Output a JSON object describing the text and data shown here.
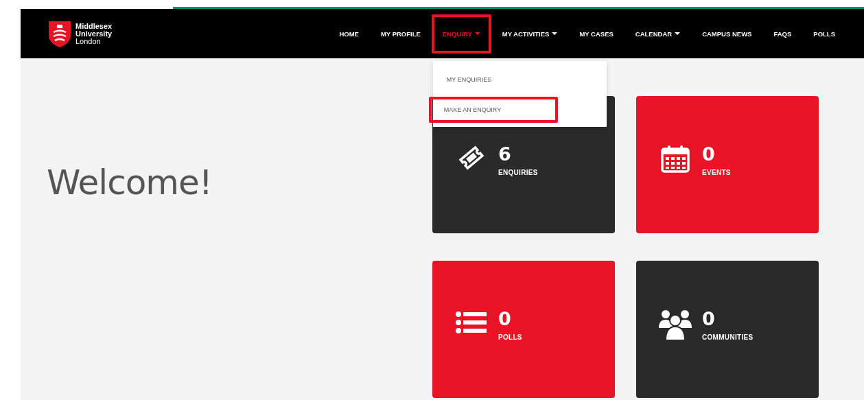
{
  "logo": {
    "lines": [
      "Middlesex",
      "University",
      "London"
    ]
  },
  "nav": [
    {
      "label": "HOME",
      "caret": false,
      "selected": false,
      "highlighted": false
    },
    {
      "label": "MY PROFILE",
      "caret": false,
      "selected": false,
      "highlighted": false
    },
    {
      "label": "ENQUIRY",
      "caret": true,
      "selected": true,
      "highlighted": true,
      "expanded": true,
      "menu": [
        {
          "label": "MY ENQUIRIES",
          "highlighted": false
        },
        {
          "label": "MAKE AN ENQUIRY",
          "highlighted": true
        }
      ]
    },
    {
      "label": "MY ACTIVITIES",
      "caret": true,
      "selected": false,
      "highlighted": false
    },
    {
      "label": "MY CASES",
      "caret": false,
      "selected": false,
      "highlighted": false
    },
    {
      "label": "CALENDAR",
      "caret": true,
      "selected": false,
      "highlighted": false
    },
    {
      "label": "CAMPUS NEWS",
      "caret": false,
      "selected": false,
      "highlighted": false
    },
    {
      "label": "FAQS",
      "caret": false,
      "selected": false,
      "highlighted": false
    },
    {
      "label": "POLLS",
      "caret": false,
      "selected": false,
      "highlighted": false
    }
  ],
  "welcome": "Welcome!",
  "tiles": [
    {
      "kind": "ticket",
      "count": "6",
      "label": "ENQUIRIES",
      "color": "#2a2a2b"
    },
    {
      "kind": "calendar",
      "count": "0",
      "label": "EVENTS",
      "color": "#e81324"
    },
    {
      "kind": "list",
      "count": "0",
      "label": "POLLS",
      "color": "#e81324"
    },
    {
      "kind": "people",
      "count": "0",
      "label": "COMMUNITIES",
      "color": "#2a2a2b"
    }
  ]
}
